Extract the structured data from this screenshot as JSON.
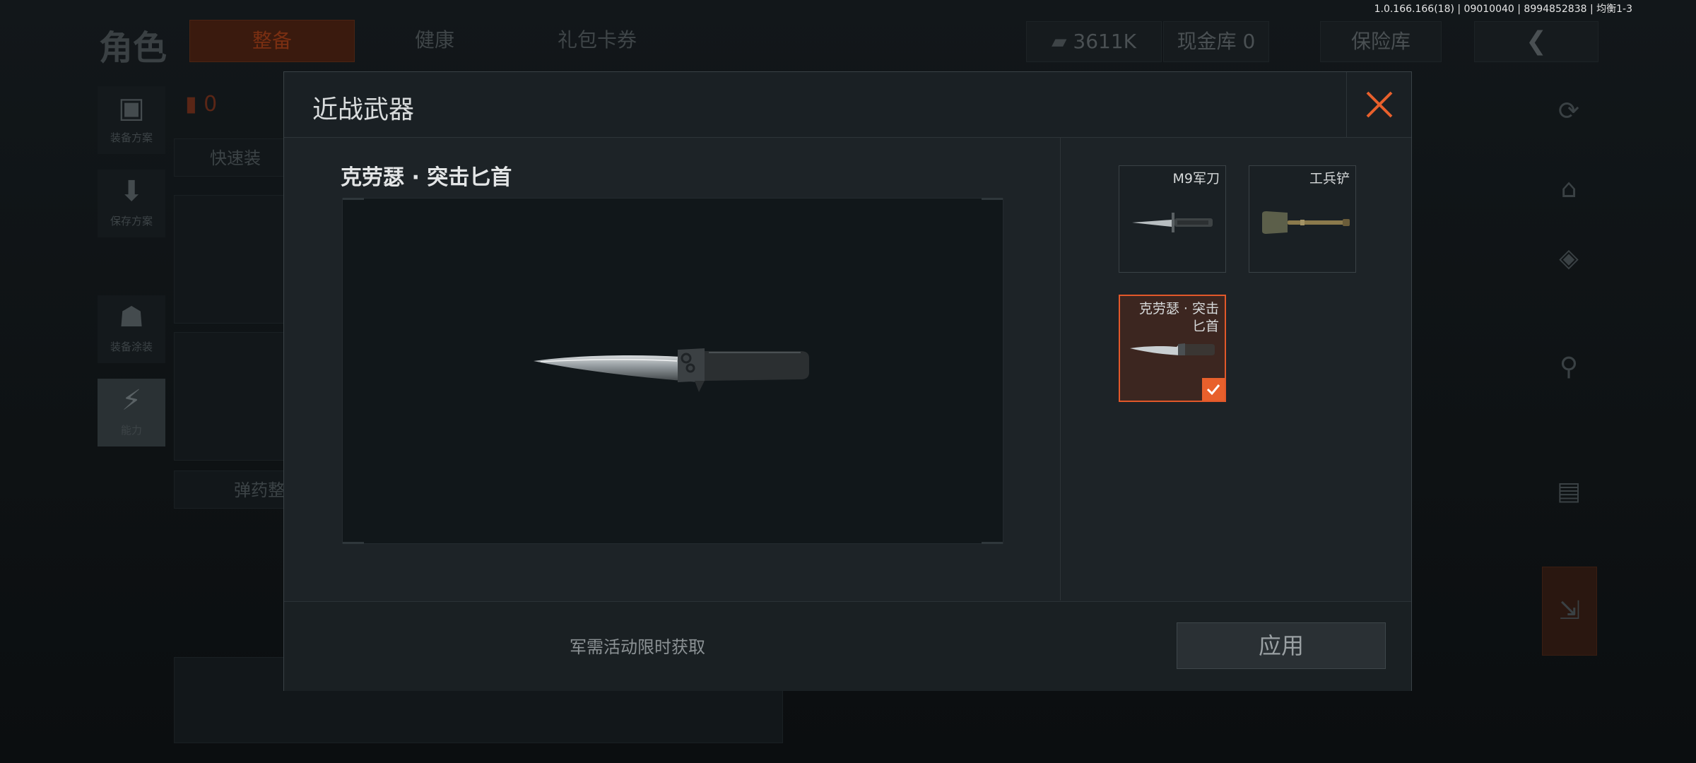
{
  "version_info": "1.0.166.166(18) | 09010040 | 8994852838 | 均衡1-3",
  "background": {
    "page_title": "角色",
    "tabs": [
      "整备",
      "健康",
      "礼包卡券"
    ],
    "currency_amount": "3611K",
    "cash_vault": "现金库 0",
    "safe_vault": "保险库",
    "side_items": [
      "装备方案",
      "保存方案",
      "装备涂装",
      "能力"
    ],
    "quick_equip": "快速装",
    "ammo_label": "弹药整",
    "armor_count": "0"
  },
  "modal": {
    "title": "近战武器",
    "selected_item_name": "克劳瑟 · 突击匕首",
    "footer_note": "军需活动限时获取",
    "apply_label": "应用",
    "weapons": [
      {
        "name": "M9军刀",
        "icon": "bayonet-icon",
        "selected": false
      },
      {
        "name": "工兵铲",
        "icon": "shovel-icon",
        "selected": false
      },
      {
        "name": "克劳瑟 · 突击\n匕首",
        "icon": "combat-knife-icon",
        "selected": true
      }
    ]
  },
  "colors": {
    "accent": "#e8602c",
    "modal_bg": "#1d2327",
    "preview_bg": "#11171a"
  }
}
